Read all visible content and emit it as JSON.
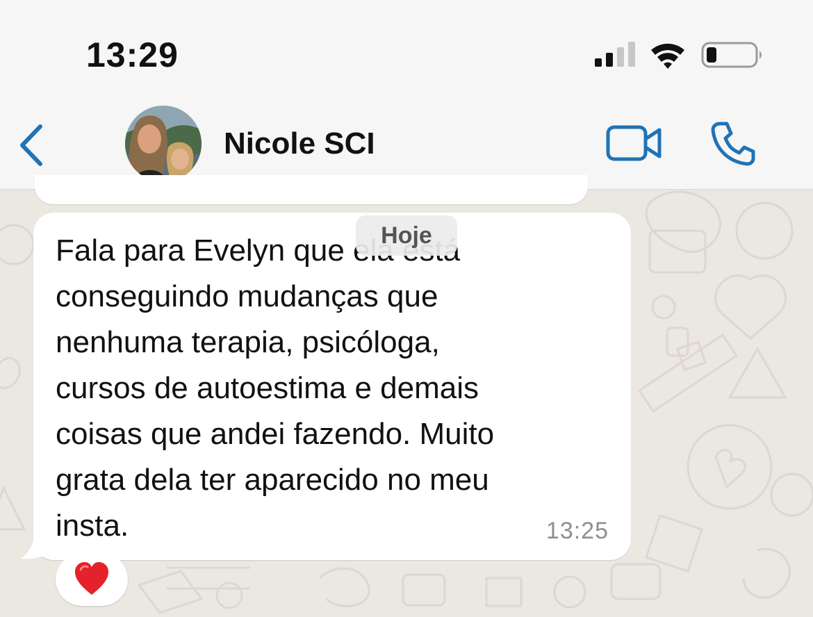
{
  "status_bar": {
    "time": "13:29",
    "icons": [
      "cellular-signal-icon",
      "wifi-icon",
      "battery-low-icon"
    ]
  },
  "header": {
    "contact_name": "Nicole SCI",
    "icons": [
      "chevron-left-icon",
      "video-camera-icon",
      "phone-icon"
    ],
    "accent_color": "#1f73b7"
  },
  "chat": {
    "date_separator": "Hoje",
    "messages": [
      {
        "text_lines": [
          "Fala para Evelyn que ela está",
          "conseguindo mudanças que",
          "nenhuma terapia, psicóloga,",
          "cursos de autoestima e demais",
          "coisas que andei fazendo. Muito",
          "grata dela ter aparecido no meu",
          "insta."
        ],
        "time": "13:25",
        "reaction": "❤️"
      }
    ]
  }
}
